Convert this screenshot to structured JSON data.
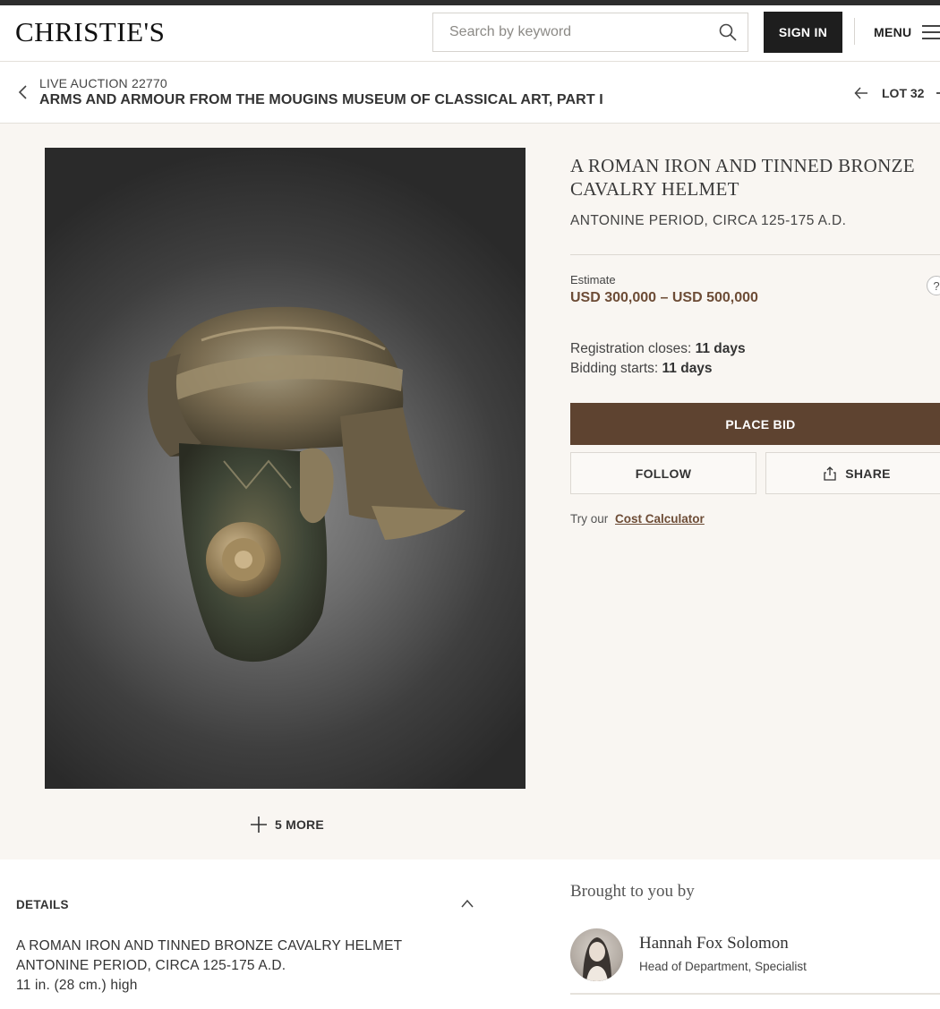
{
  "header": {
    "logo": "CHRISTIE'S",
    "search_placeholder": "Search by keyword",
    "signin_label": "SIGN IN",
    "menu_label": "MENU"
  },
  "sale": {
    "number": "LIVE AUCTION 22770",
    "title": "ARMS AND ARMOUR FROM THE MOUGINS MUSEUM OF CLASSICAL ART, PART I",
    "lot_label": "LOT 32"
  },
  "gallery": {
    "more_label": "5 MORE"
  },
  "lot": {
    "title": "A ROMAN IRON AND TINNED BRONZE CAVALRY HELMET",
    "subtitle": "ANTONINE PERIOD, CIRCA 125-175 A.D.",
    "estimate_label": "Estimate",
    "estimate_value": "USD 300,000 – USD 500,000",
    "help_glyph": "?",
    "registration_label": "Registration closes:",
    "registration_value": "11 days",
    "bidding_label": "Bidding starts:",
    "bidding_value": "11 days",
    "place_bid_label": "PLACE BID",
    "follow_label": "FOLLOW",
    "share_label": "SHARE",
    "calc_prefix": "Try our",
    "calc_link": "Cost Calculator"
  },
  "details": {
    "label": "DETAILS",
    "lines": [
      "A ROMAN IRON AND TINNED BRONZE CAVALRY HELMET",
      "ANTONINE PERIOD, CIRCA 125-175 A.D.",
      "11 in. (28 cm.) high"
    ]
  },
  "specialist": {
    "heading": "Brought to you by",
    "name": "Hannah Fox Solomon",
    "role": "Head of Department, Specialist"
  },
  "colors": {
    "accent": "#5e4330",
    "estimate": "#6d4c36",
    "background": "#f9f6f2"
  }
}
